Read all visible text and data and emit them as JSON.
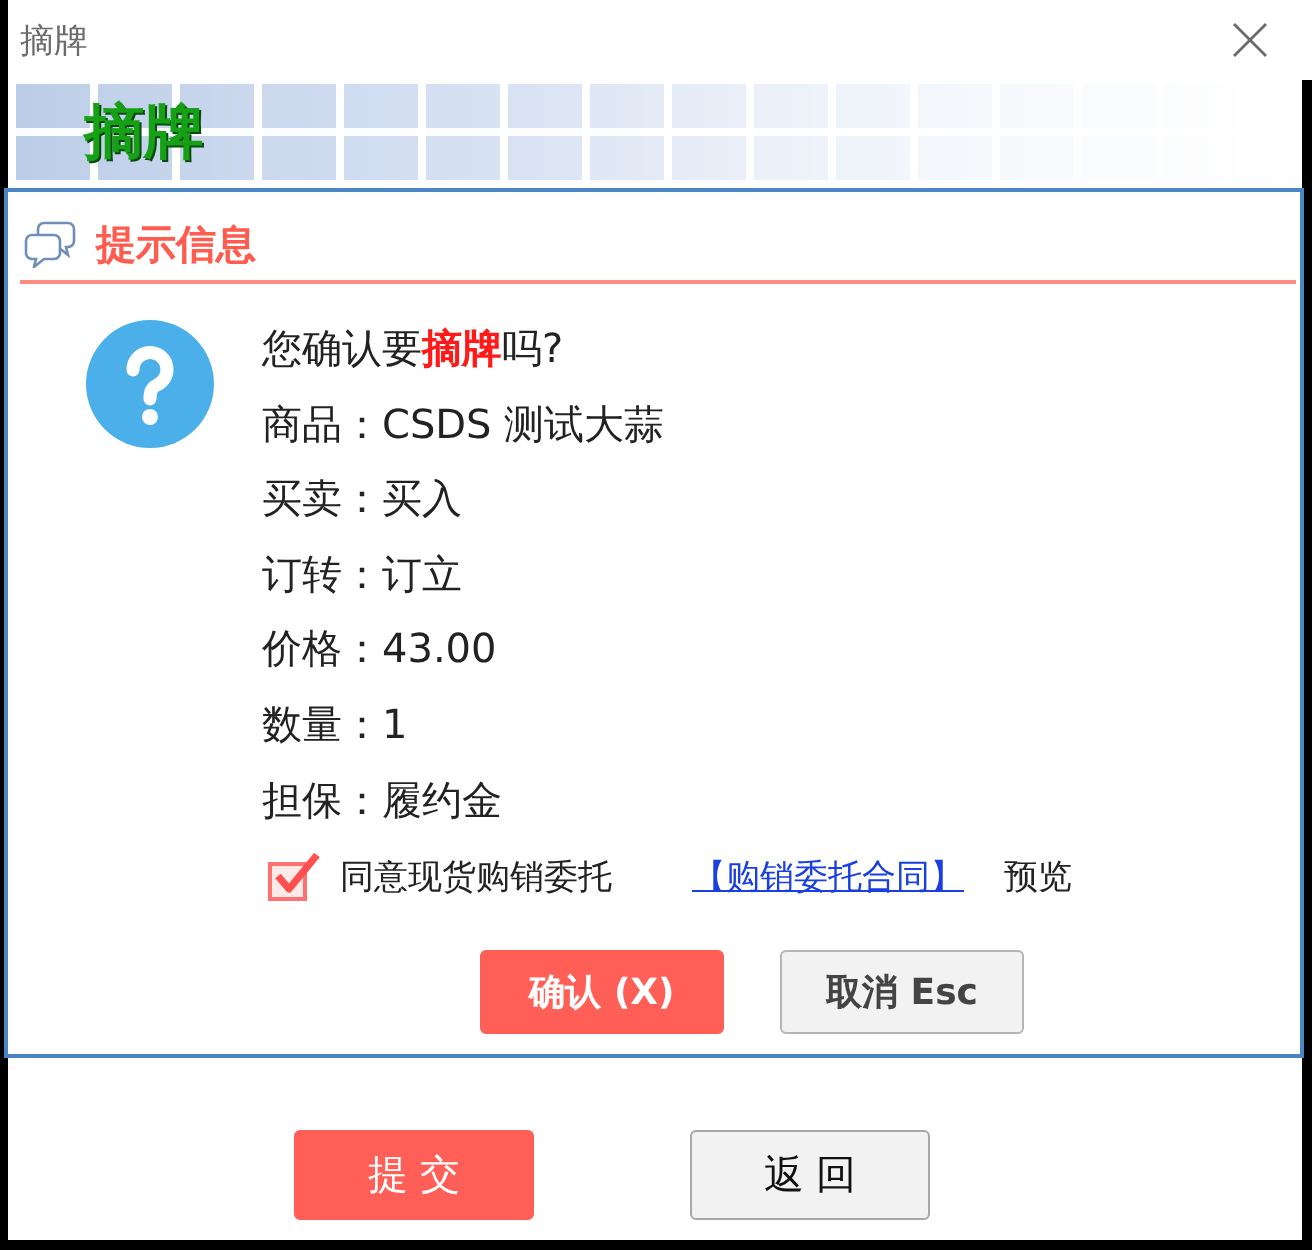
{
  "window": {
    "title": "摘牌",
    "banner_title": "摘牌"
  },
  "dialog": {
    "title": "提示信息",
    "question": "您确认要**摘牌**吗?",
    "fields": [
      {
        "label": "商品：",
        "value": "CSDS 测试大蒜"
      },
      {
        "label": "买卖：",
        "value": "买入"
      },
      {
        "label": "订转：",
        "value": "订立"
      },
      {
        "label": "价格：",
        "value": "43.00"
      },
      {
        "label": "数量：",
        "value": "1"
      },
      {
        "label": "担保：",
        "value": "履约金"
      }
    ],
    "agreement": {
      "checked": true,
      "label": "同意现货购销委托",
      "link": "【购销委托合同】",
      "suffix": "预览"
    },
    "buttons": [
      {
        "label": "确认 (X)",
        "kind": "primary"
      },
      {
        "label": "取消 Esc",
        "kind": "secondary"
      }
    ]
  },
  "footer_buttons": [
    {
      "label": "提 交",
      "kind": "primary"
    },
    {
      "label": "返 回",
      "kind": "secondary"
    }
  ]
}
